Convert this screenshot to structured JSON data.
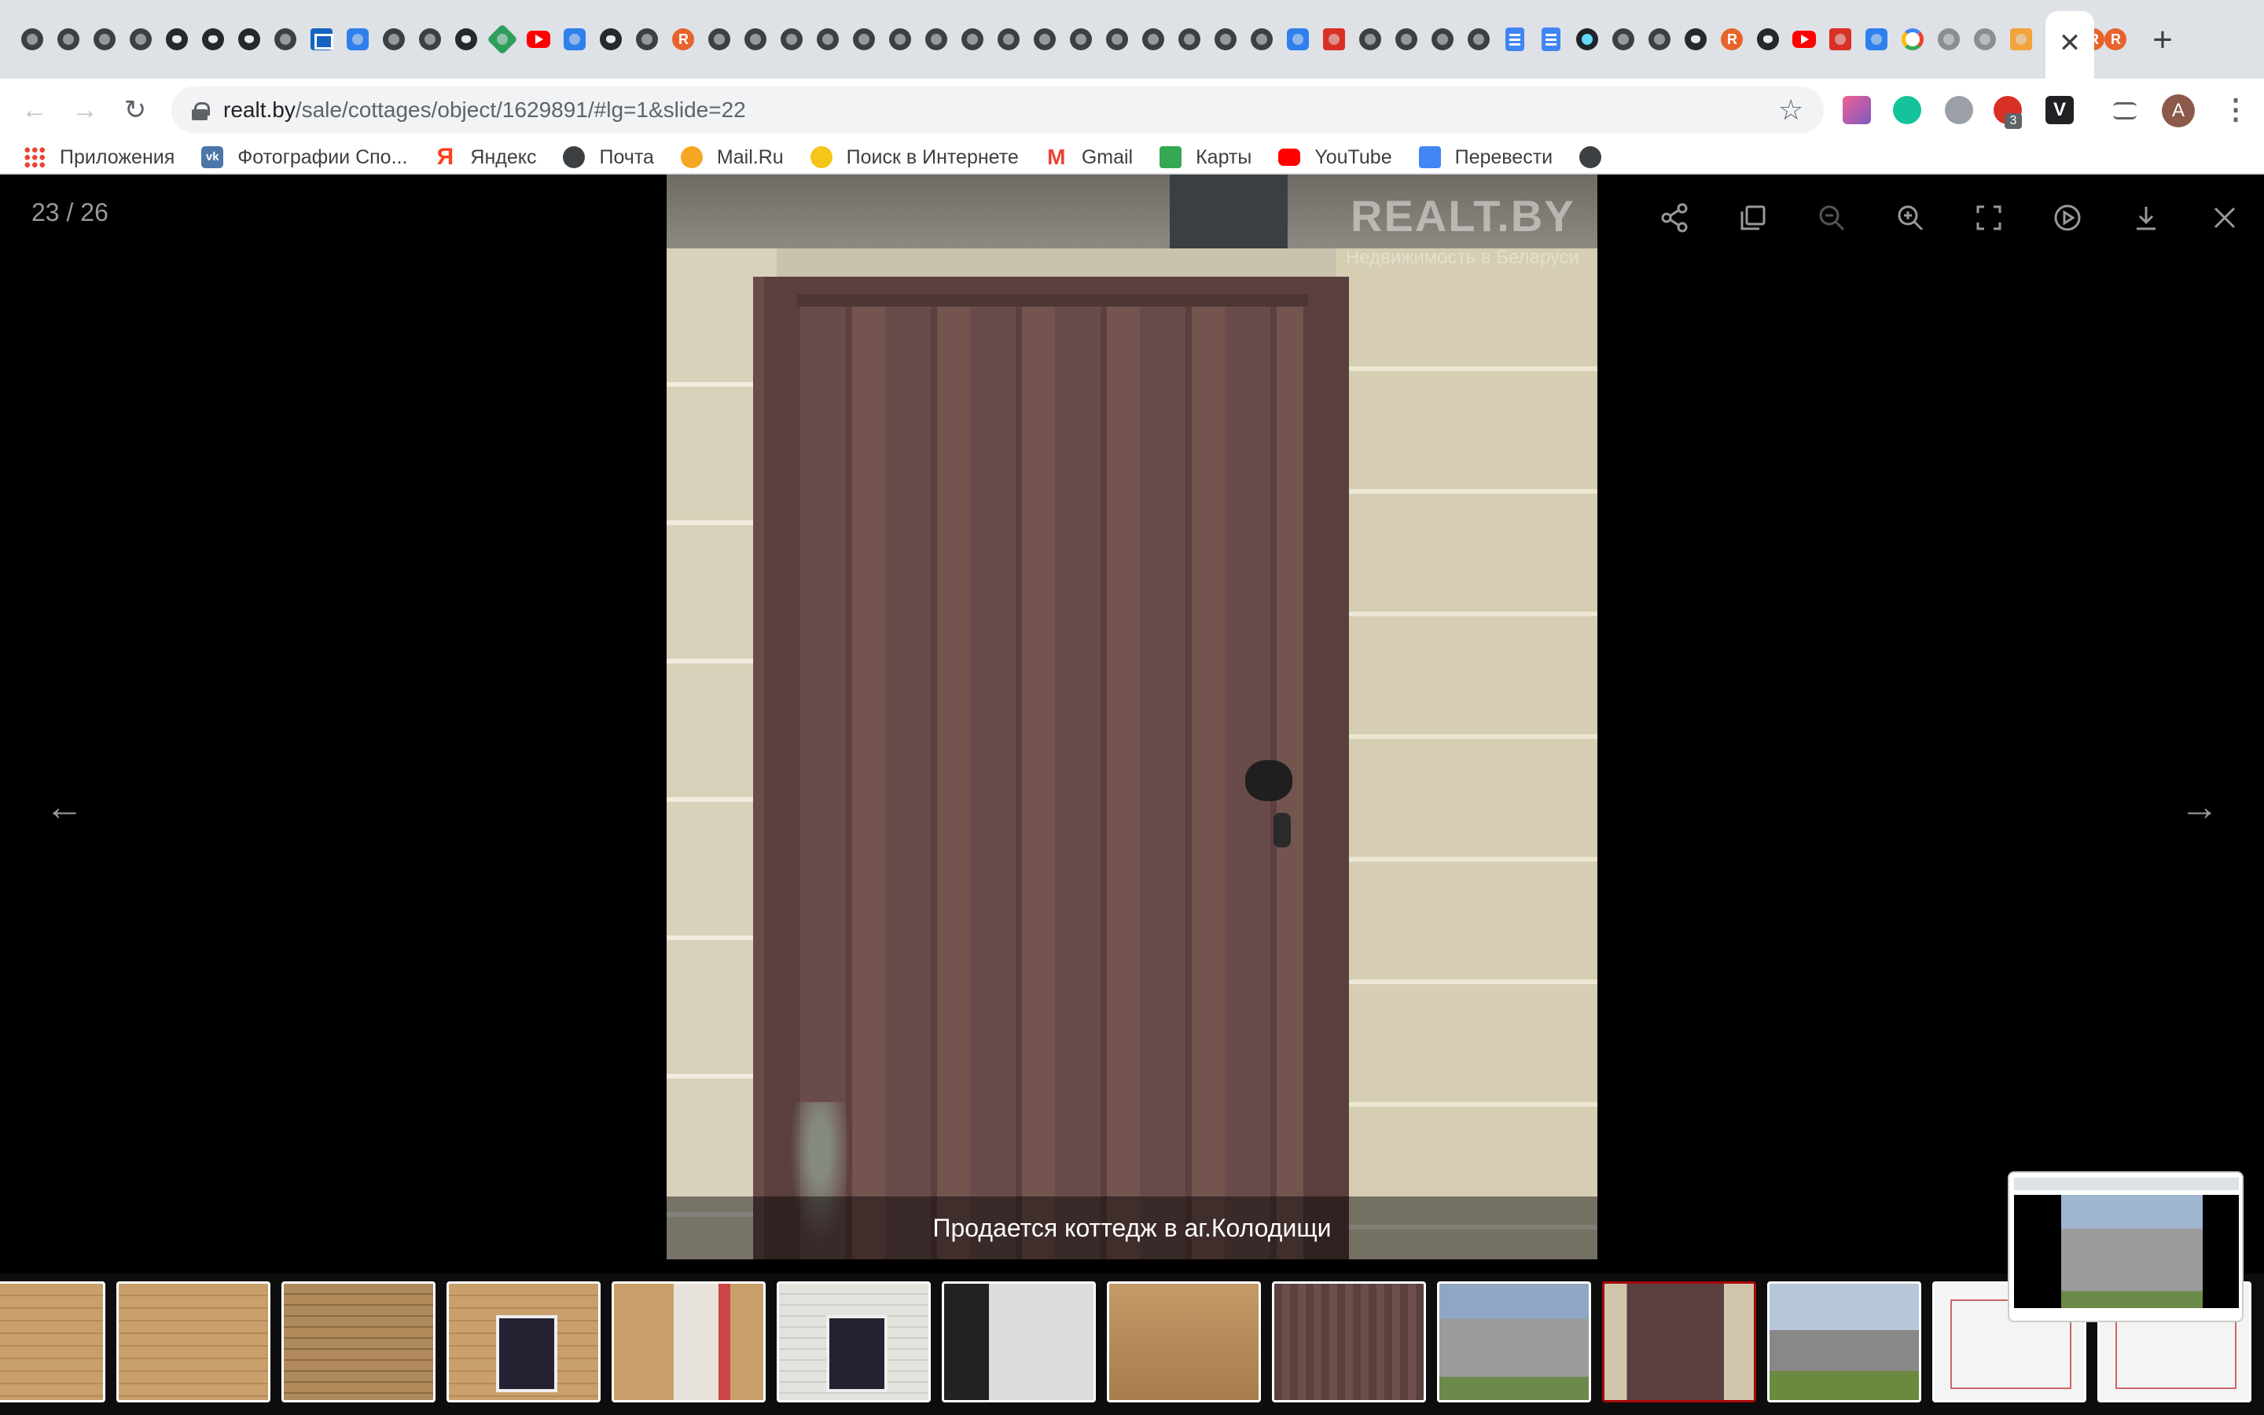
{
  "browser": {
    "tab_icons": [
      "globe",
      "globe",
      "globe",
      "globe",
      "github",
      "github",
      "github",
      "globe",
      "mail",
      "google-translate",
      "globe",
      "globe",
      "github",
      "green",
      "youtube",
      "blue",
      "github",
      "globe",
      "realt",
      "globe",
      "globe",
      "globe",
      "globe",
      "globe",
      "globe",
      "globe",
      "globe",
      "globe",
      "globe",
      "globe",
      "globe",
      "globe",
      "globe",
      "globe",
      "globe",
      "blue",
      "red",
      "globe",
      "globe",
      "globe",
      "globe",
      "doc",
      "doc",
      "react",
      "globe",
      "globe",
      "github",
      "realt",
      "github",
      "youtube",
      "red",
      "blue",
      "google",
      "gray",
      "gray",
      "orange",
      "realt",
      "realt"
    ],
    "active_tab_close": "✕",
    "after_tab_icon": "realt",
    "new_tab_label": "+",
    "url_host": "realt.by",
    "url_path": "/sale/cottages/object/1629891/#lg=1&slide=22",
    "extension_badge": "3",
    "profile_initial": "A"
  },
  "bookmarks": [
    {
      "label": "Приложения",
      "icon": "apps-icon"
    },
    {
      "label": "Фотографии Спо...",
      "icon": "vk-icon"
    },
    {
      "label": "Яндекс",
      "icon": "yandex-icon"
    },
    {
      "label": "Почта",
      "icon": "globe-icon"
    },
    {
      "label": "Mail.Ru",
      "icon": "mailru-icon"
    },
    {
      "label": "Поиск в Интернете",
      "icon": "search-icon"
    },
    {
      "label": "Gmail",
      "icon": "gmail-icon"
    },
    {
      "label": "Карты",
      "icon": "maps-icon"
    },
    {
      "label": "YouTube",
      "icon": "youtube-icon"
    },
    {
      "label": "Перевести",
      "icon": "translate-icon"
    },
    {
      "label": "",
      "icon": "globe-icon"
    }
  ],
  "gallery": {
    "counter": "23 / 26",
    "caption": "Продается коттедж в аг.Колодищи",
    "watermark": "REALT.BY",
    "watermark_sub": "Недвижимость в Беларуси",
    "toolbar": [
      "share",
      "thumbnails",
      "zoom-out",
      "zoom-in",
      "fullscreen",
      "autoplay",
      "download",
      "close"
    ],
    "thumbnails": [
      {
        "kind": "wood"
      },
      {
        "kind": "wood"
      },
      {
        "kind": "wood-dark"
      },
      {
        "kind": "wood-window"
      },
      {
        "kind": "boiler"
      },
      {
        "kind": "white-window"
      },
      {
        "kind": "porch"
      },
      {
        "kind": "bath"
      },
      {
        "kind": "gate"
      },
      {
        "kind": "gate2"
      },
      {
        "kind": "door",
        "active": true
      },
      {
        "kind": "house"
      },
      {
        "kind": "plan"
      },
      {
        "kind": "plan"
      }
    ]
  }
}
